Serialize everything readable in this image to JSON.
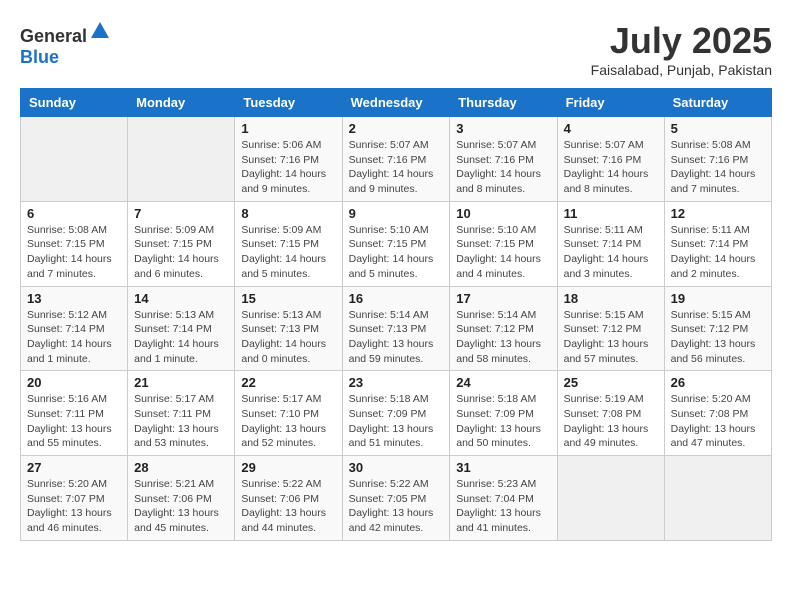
{
  "header": {
    "logo_general": "General",
    "logo_blue": "Blue",
    "title": "July 2025",
    "subtitle": "Faisalabad, Punjab, Pakistan"
  },
  "days_of_week": [
    "Sunday",
    "Monday",
    "Tuesday",
    "Wednesday",
    "Thursday",
    "Friday",
    "Saturday"
  ],
  "weeks": [
    [
      {
        "day": "",
        "info": ""
      },
      {
        "day": "",
        "info": ""
      },
      {
        "day": "1",
        "info": "Sunrise: 5:06 AM\nSunset: 7:16 PM\nDaylight: 14 hours and 9 minutes."
      },
      {
        "day": "2",
        "info": "Sunrise: 5:07 AM\nSunset: 7:16 PM\nDaylight: 14 hours and 9 minutes."
      },
      {
        "day": "3",
        "info": "Sunrise: 5:07 AM\nSunset: 7:16 PM\nDaylight: 14 hours and 8 minutes."
      },
      {
        "day": "4",
        "info": "Sunrise: 5:07 AM\nSunset: 7:16 PM\nDaylight: 14 hours and 8 minutes."
      },
      {
        "day": "5",
        "info": "Sunrise: 5:08 AM\nSunset: 7:16 PM\nDaylight: 14 hours and 7 minutes."
      }
    ],
    [
      {
        "day": "6",
        "info": "Sunrise: 5:08 AM\nSunset: 7:15 PM\nDaylight: 14 hours and 7 minutes."
      },
      {
        "day": "7",
        "info": "Sunrise: 5:09 AM\nSunset: 7:15 PM\nDaylight: 14 hours and 6 minutes."
      },
      {
        "day": "8",
        "info": "Sunrise: 5:09 AM\nSunset: 7:15 PM\nDaylight: 14 hours and 5 minutes."
      },
      {
        "day": "9",
        "info": "Sunrise: 5:10 AM\nSunset: 7:15 PM\nDaylight: 14 hours and 5 minutes."
      },
      {
        "day": "10",
        "info": "Sunrise: 5:10 AM\nSunset: 7:15 PM\nDaylight: 14 hours and 4 minutes."
      },
      {
        "day": "11",
        "info": "Sunrise: 5:11 AM\nSunset: 7:14 PM\nDaylight: 14 hours and 3 minutes."
      },
      {
        "day": "12",
        "info": "Sunrise: 5:11 AM\nSunset: 7:14 PM\nDaylight: 14 hours and 2 minutes."
      }
    ],
    [
      {
        "day": "13",
        "info": "Sunrise: 5:12 AM\nSunset: 7:14 PM\nDaylight: 14 hours and 1 minute."
      },
      {
        "day": "14",
        "info": "Sunrise: 5:13 AM\nSunset: 7:14 PM\nDaylight: 14 hours and 1 minute."
      },
      {
        "day": "15",
        "info": "Sunrise: 5:13 AM\nSunset: 7:13 PM\nDaylight: 14 hours and 0 minutes."
      },
      {
        "day": "16",
        "info": "Sunrise: 5:14 AM\nSunset: 7:13 PM\nDaylight: 13 hours and 59 minutes."
      },
      {
        "day": "17",
        "info": "Sunrise: 5:14 AM\nSunset: 7:12 PM\nDaylight: 13 hours and 58 minutes."
      },
      {
        "day": "18",
        "info": "Sunrise: 5:15 AM\nSunset: 7:12 PM\nDaylight: 13 hours and 57 minutes."
      },
      {
        "day": "19",
        "info": "Sunrise: 5:15 AM\nSunset: 7:12 PM\nDaylight: 13 hours and 56 minutes."
      }
    ],
    [
      {
        "day": "20",
        "info": "Sunrise: 5:16 AM\nSunset: 7:11 PM\nDaylight: 13 hours and 55 minutes."
      },
      {
        "day": "21",
        "info": "Sunrise: 5:17 AM\nSunset: 7:11 PM\nDaylight: 13 hours and 53 minutes."
      },
      {
        "day": "22",
        "info": "Sunrise: 5:17 AM\nSunset: 7:10 PM\nDaylight: 13 hours and 52 minutes."
      },
      {
        "day": "23",
        "info": "Sunrise: 5:18 AM\nSunset: 7:09 PM\nDaylight: 13 hours and 51 minutes."
      },
      {
        "day": "24",
        "info": "Sunrise: 5:18 AM\nSunset: 7:09 PM\nDaylight: 13 hours and 50 minutes."
      },
      {
        "day": "25",
        "info": "Sunrise: 5:19 AM\nSunset: 7:08 PM\nDaylight: 13 hours and 49 minutes."
      },
      {
        "day": "26",
        "info": "Sunrise: 5:20 AM\nSunset: 7:08 PM\nDaylight: 13 hours and 47 minutes."
      }
    ],
    [
      {
        "day": "27",
        "info": "Sunrise: 5:20 AM\nSunset: 7:07 PM\nDaylight: 13 hours and 46 minutes."
      },
      {
        "day": "28",
        "info": "Sunrise: 5:21 AM\nSunset: 7:06 PM\nDaylight: 13 hours and 45 minutes."
      },
      {
        "day": "29",
        "info": "Sunrise: 5:22 AM\nSunset: 7:06 PM\nDaylight: 13 hours and 44 minutes."
      },
      {
        "day": "30",
        "info": "Sunrise: 5:22 AM\nSunset: 7:05 PM\nDaylight: 13 hours and 42 minutes."
      },
      {
        "day": "31",
        "info": "Sunrise: 5:23 AM\nSunset: 7:04 PM\nDaylight: 13 hours and 41 minutes."
      },
      {
        "day": "",
        "info": ""
      },
      {
        "day": "",
        "info": ""
      }
    ]
  ]
}
